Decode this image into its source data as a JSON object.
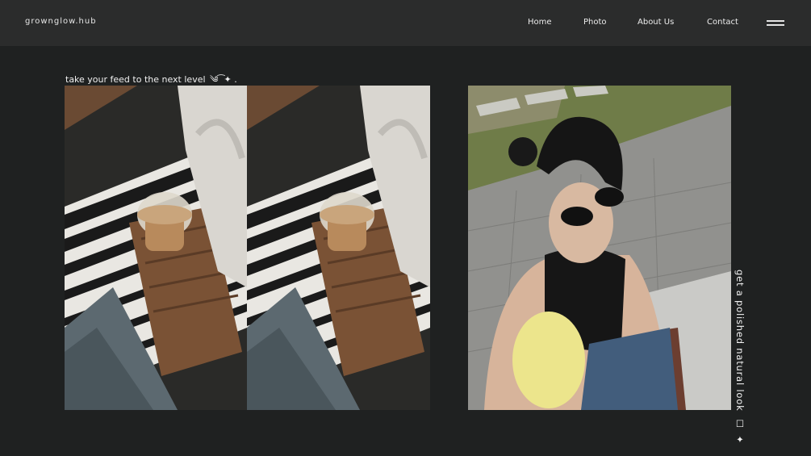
{
  "nav": {
    "brand": "grownglow.hub",
    "links": [
      "Home",
      "Photo",
      "About Us",
      "Contact"
    ],
    "menu_icon": "hamburger-menu-icon"
  },
  "hero": {
    "tagline": "take your feed to the next level",
    "tagline_ornament": "༄ ͡ ✦ .",
    "side_caption": "get a polished natural look",
    "side_caption_icons": "☐ ✦"
  },
  "colors": {
    "background": "#1f2121",
    "navbar": "#2b2c2c",
    "text": "#ececec"
  }
}
